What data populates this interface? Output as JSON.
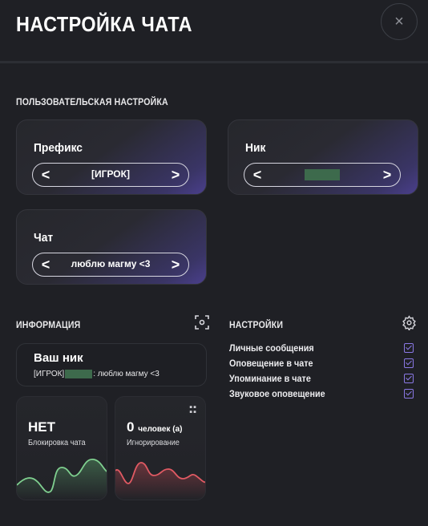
{
  "header": {
    "title": "НАСТРОЙКА ЧАТА",
    "close_icon": "×"
  },
  "user_settings": {
    "section_title": "ПОЛЬЗОВАТЕЛЬСКАЯ НАСТРОЙКА",
    "prefix": {
      "label": "Префикс",
      "value": "[ИГРОК]"
    },
    "nick": {
      "label": "Ник",
      "value": ""
    },
    "chat": {
      "label": "Чат",
      "value": "люблю магму <3"
    },
    "arrow_left": "<",
    "arrow_right": ">"
  },
  "info": {
    "section_title": "ИНФОРМАЦИЯ",
    "nick_box": {
      "title": "Ваш ник",
      "prefix": "[ИГРОК]",
      "suffix": ": люблю магму <3"
    },
    "blocked": {
      "value": "НЕТ",
      "label": "Блокировка чата",
      "color": "#7fcf8f"
    },
    "ignored": {
      "value": "0",
      "unit": "человек (а)",
      "label": "Игнорирование",
      "color": "#e05a63"
    }
  },
  "settings": {
    "section_title": "НАСТРОЙКИ",
    "items": [
      {
        "label": "Личные сообщения",
        "checked": true
      },
      {
        "label": "Оповещение в чате",
        "checked": true
      },
      {
        "label": "Упоминание в чате",
        "checked": true
      },
      {
        "label": "Звуковое оповещение",
        "checked": true
      }
    ],
    "accent": "#8b79e6"
  }
}
